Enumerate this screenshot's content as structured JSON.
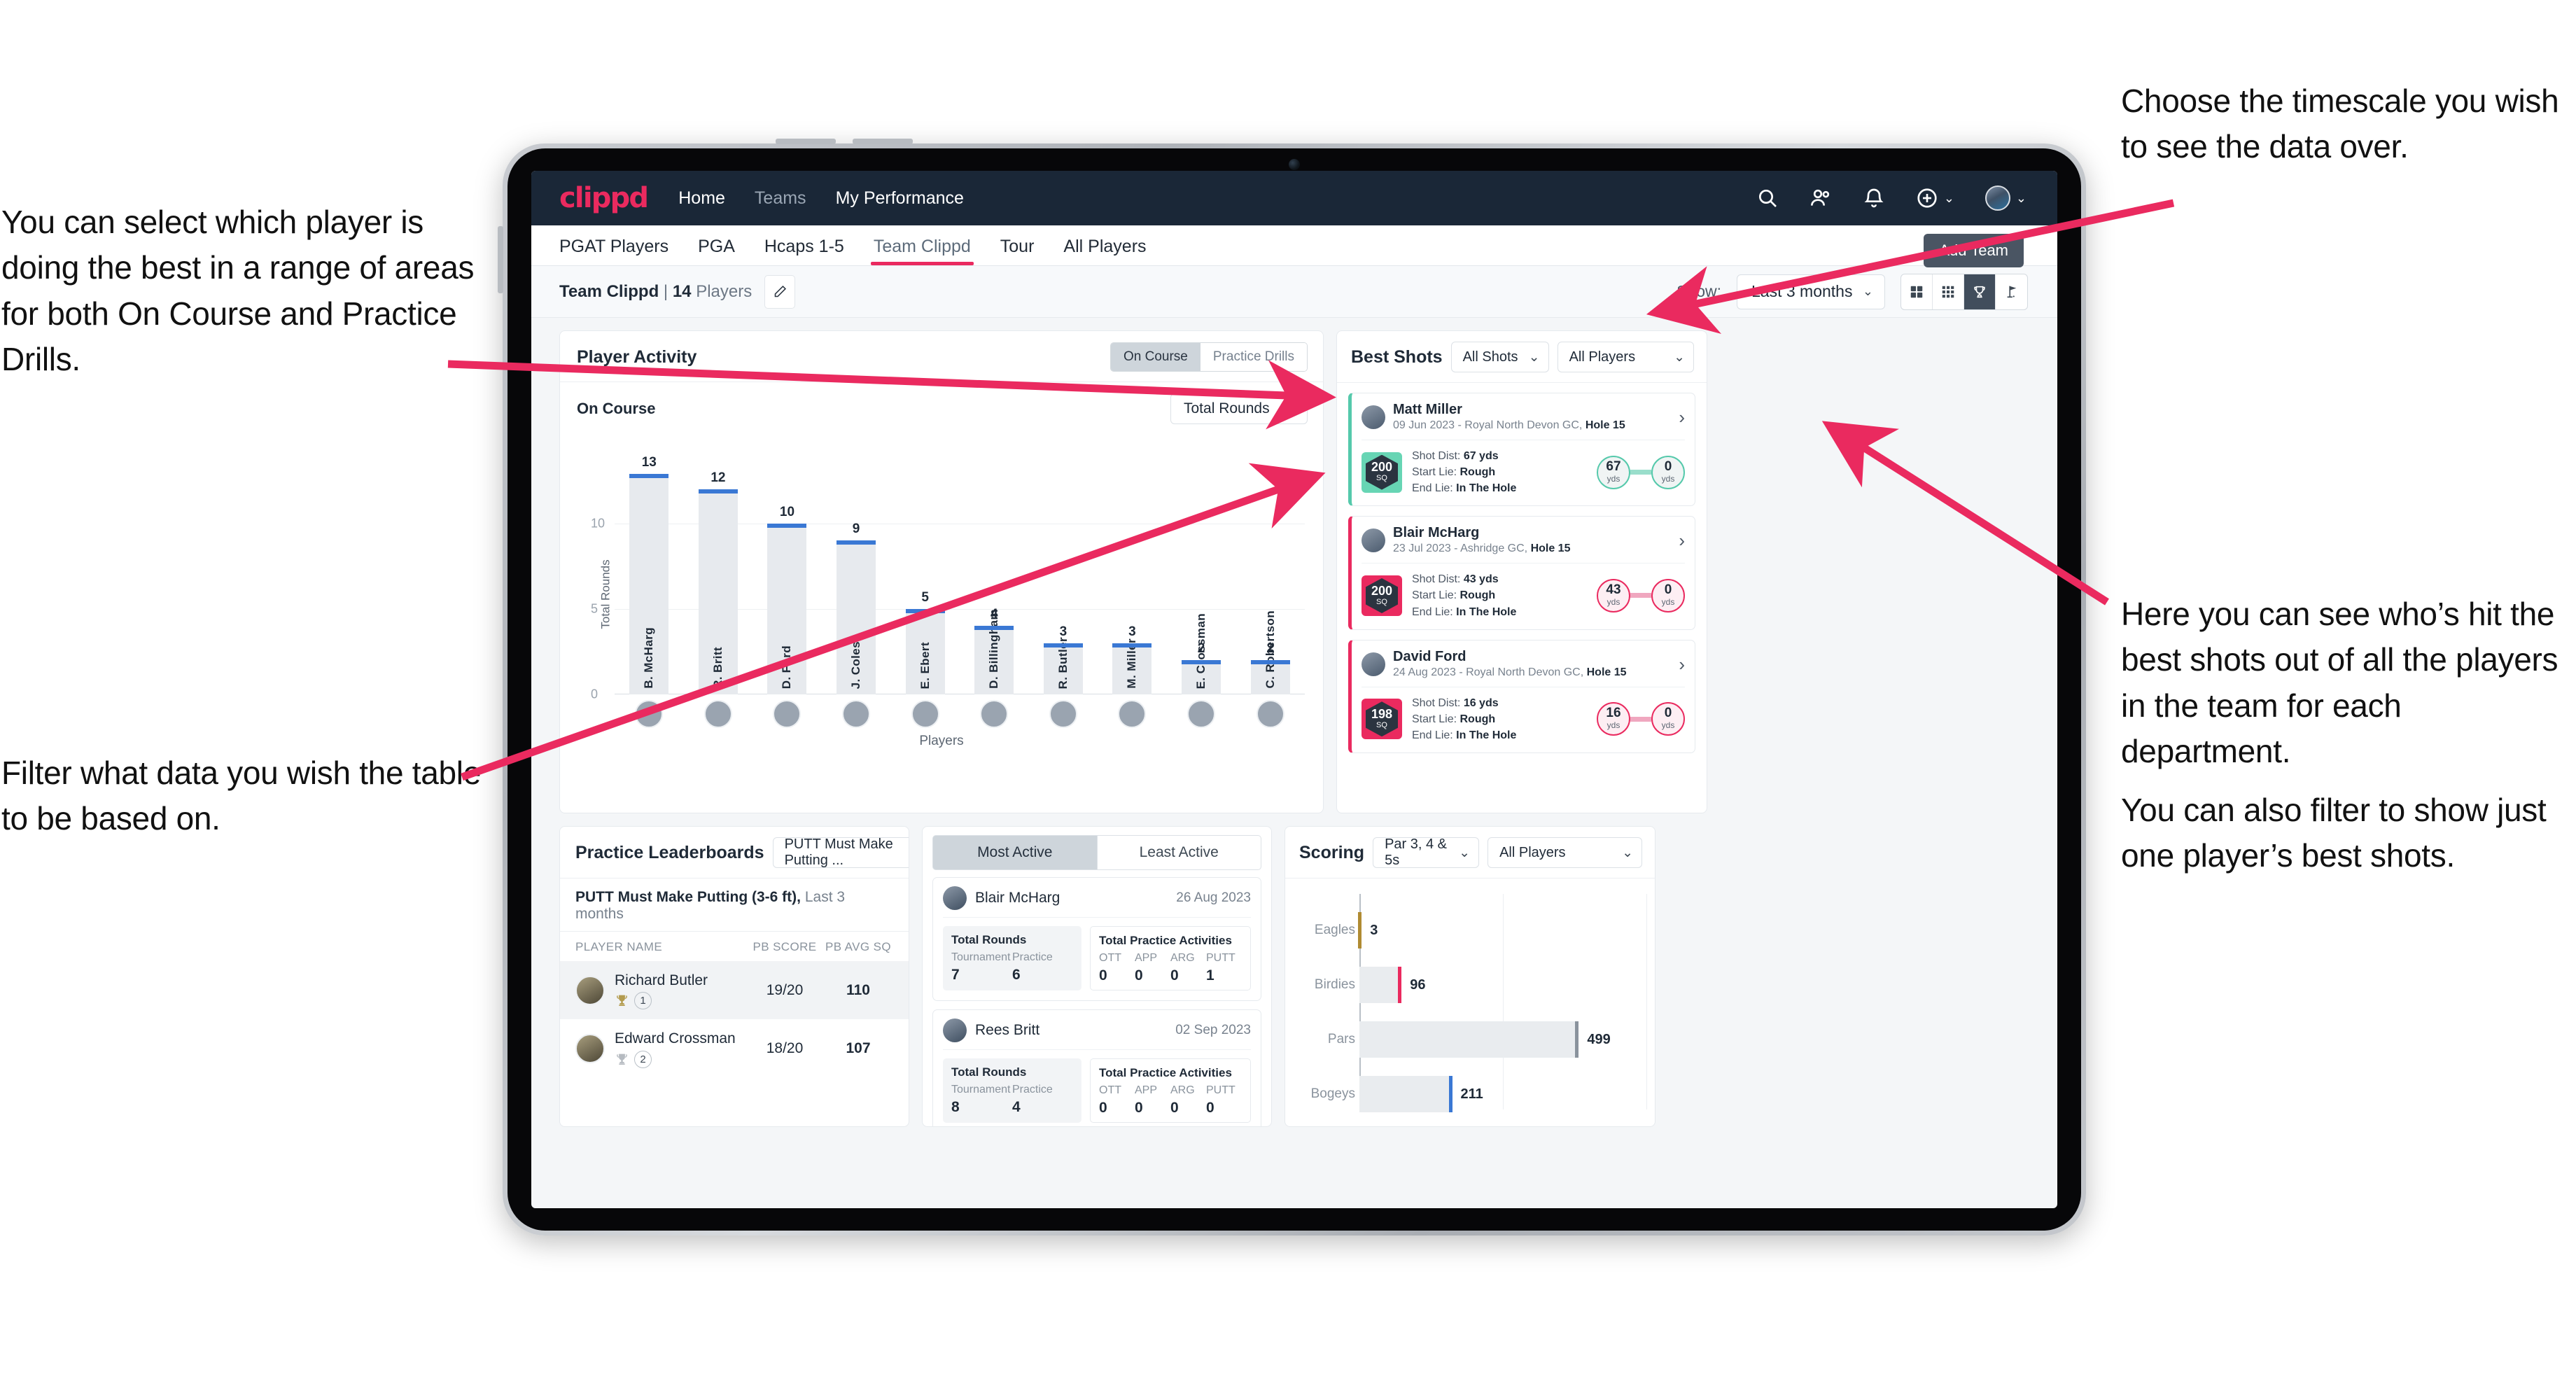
{
  "annotations": {
    "left_top": "You can select which player is doing the best in a range of areas for both On Course and Practice Drills.",
    "left_bottom": "Filter what data you wish the table to be based on.",
    "top_right": "Choose the timescale you wish to see the data over.",
    "right_1": "Here you can see who’s hit the best shots out of all the players in the team for each department.",
    "right_2": "You can also filter to show just one player’s best shots."
  },
  "navbar": {
    "logo": "clippd",
    "links": [
      {
        "label": "Home",
        "dim": false
      },
      {
        "label": "Teams",
        "dim": true
      },
      {
        "label": "My Performance",
        "dim": false
      }
    ],
    "icons": [
      "search-icon",
      "people-icon",
      "bell-icon",
      "plus-circle-icon",
      "avatar"
    ]
  },
  "tabs": [
    {
      "label": "PGAT Players",
      "active": false
    },
    {
      "label": "PGA",
      "active": false
    },
    {
      "label": "Hcaps 1-5",
      "active": false
    },
    {
      "label": "Team Clippd",
      "active": true
    },
    {
      "label": "Tour",
      "active": false
    },
    {
      "label": "All Players",
      "active": false
    }
  ],
  "tooltip": {
    "add_team": "Add Team"
  },
  "toolbar": {
    "team_name": "Team Clippd",
    "separator": "|",
    "player_count": "14",
    "players_word": "Players",
    "edit_icon": "pencil-icon",
    "show_label": "Show:",
    "timescale_value": "Last 3 months",
    "view_buttons": [
      "grid-large-icon",
      "grid-small-icon",
      "trophy-icon",
      "flag-icon"
    ],
    "active_view": "trophy-icon"
  },
  "player_activity": {
    "title": "Player Activity",
    "segments": [
      {
        "label": "On Course",
        "active": true
      },
      {
        "label": "Practice Drills",
        "active": false
      }
    ],
    "sub_title": "On Course",
    "metric_select": "Total Rounds"
  },
  "chart_data": [
    {
      "type": "bar",
      "title": "Player Activity – On Course",
      "xlabel": "Players",
      "ylabel": "Total Rounds",
      "categories": [
        "B. McHarg",
        "R. Britt",
        "D. Ford",
        "J. Coles",
        "E. Ebert",
        "D. Billingham",
        "R. Butler",
        "M. Miller",
        "E. Crossman",
        "C. Robertson"
      ],
      "values": [
        13,
        12,
        10,
        9,
        5,
        4,
        3,
        3,
        2,
        2
      ],
      "ylim": [
        0,
        14
      ],
      "yticks": [
        0,
        5,
        10
      ],
      "grid": true,
      "bar_color": "#e7eaee",
      "cap_color": "#3a78d4"
    },
    {
      "type": "bar",
      "orientation": "horizontal",
      "title": "Scoring",
      "categories": [
        "Eagles",
        "Birdies",
        "Pars",
        "Bogeys"
      ],
      "values": [
        3,
        96,
        499,
        211
      ],
      "xlim": [
        0,
        640
      ],
      "colors": [
        "#b08b32",
        "#ea2a5f",
        "#8a939d",
        "#3a78d4"
      ],
      "grid": true
    }
  ],
  "best_shots": {
    "title": "Best Shots",
    "filter_shots": "All Shots",
    "filter_players": "All Players",
    "shots": [
      {
        "player": "Matt Miller",
        "meta_date": "09 Jun 2023 - Royal North Devon GC,",
        "meta_hole": "Hole 15",
        "sq_value": "200",
        "sq_unit": "SQ",
        "shot_dist_label": "Shot Dist:",
        "shot_dist_value": "67 yds",
        "start_lie_label": "Start Lie:",
        "start_lie_value": "Rough",
        "end_lie_label": "End Lie:",
        "end_lie_value": "In The Hole",
        "from_value": "67",
        "from_unit": "yds",
        "to_value": "0",
        "to_unit": "yds",
        "accent": "#55c9ab"
      },
      {
        "player": "Blair McHarg",
        "meta_date": "23 Jul 2023 - Ashridge GC,",
        "meta_hole": "Hole 15",
        "sq_value": "200",
        "sq_unit": "SQ",
        "shot_dist_label": "Shot Dist:",
        "shot_dist_value": "43 yds",
        "start_lie_label": "Start Lie:",
        "start_lie_value": "Rough",
        "end_lie_label": "End Lie:",
        "end_lie_value": "In The Hole",
        "from_value": "43",
        "from_unit": "yds",
        "to_value": "0",
        "to_unit": "yds",
        "accent": "#ea2a5f"
      },
      {
        "player": "David Ford",
        "meta_date": "24 Aug 2023 - Royal North Devon GC,",
        "meta_hole": "Hole 15",
        "sq_value": "198",
        "sq_unit": "SQ",
        "shot_dist_label": "Shot Dist:",
        "shot_dist_value": "16 yds",
        "start_lie_label": "Start Lie:",
        "start_lie_value": "Rough",
        "end_lie_label": "End Lie:",
        "end_lie_value": "In The Hole",
        "from_value": "16",
        "from_unit": "yds",
        "to_value": "0",
        "to_unit": "yds",
        "accent": "#ea2a5f"
      }
    ]
  },
  "practice_leaderboards": {
    "title": "Practice Leaderboards",
    "drill_select": "PUTT Must Make Putting ...",
    "sub_title_bold": "PUTT Must Make Putting (3-6 ft),",
    "sub_title_light": "Last 3 months",
    "columns": [
      "PLAYER NAME",
      "PB SCORE",
      "PB AVG SQ"
    ],
    "rows": [
      {
        "name": "Richard Butler",
        "rank": "1",
        "trophy": "gold",
        "pb_score": "19/20",
        "pb_avg_sq": "110",
        "highlight": true
      },
      {
        "name": "Edward Crossman",
        "rank": "2",
        "trophy": "silver",
        "pb_score": "18/20",
        "pb_avg_sq": "107",
        "highlight": false
      }
    ]
  },
  "activity": {
    "tabs": [
      {
        "label": "Most Active",
        "active": true
      },
      {
        "label": "Least Active",
        "active": false
      }
    ],
    "cards": [
      {
        "player": "Blair McHarg",
        "date": "26 Aug 2023",
        "rounds_title": "Total Rounds",
        "rounds_keys": [
          "Tournament",
          "Practice"
        ],
        "rounds_values": [
          "7",
          "6"
        ],
        "practice_title": "Total Practice Activities",
        "practice_keys": [
          "OTT",
          "APP",
          "ARG",
          "PUTT"
        ],
        "practice_values": [
          "0",
          "0",
          "0",
          "1"
        ]
      },
      {
        "player": "Rees Britt",
        "date": "02 Sep 2023",
        "rounds_title": "Total Rounds",
        "rounds_keys": [
          "Tournament",
          "Practice"
        ],
        "rounds_values": [
          "8",
          "4"
        ],
        "practice_title": "Total Practice Activities",
        "practice_keys": [
          "OTT",
          "APP",
          "ARG",
          "PUTT"
        ],
        "practice_values": [
          "0",
          "0",
          "0",
          "0"
        ]
      }
    ]
  },
  "scoring": {
    "title": "Scoring",
    "filter_par": "Par 3, 4 & 5s",
    "filter_players": "All Players"
  }
}
